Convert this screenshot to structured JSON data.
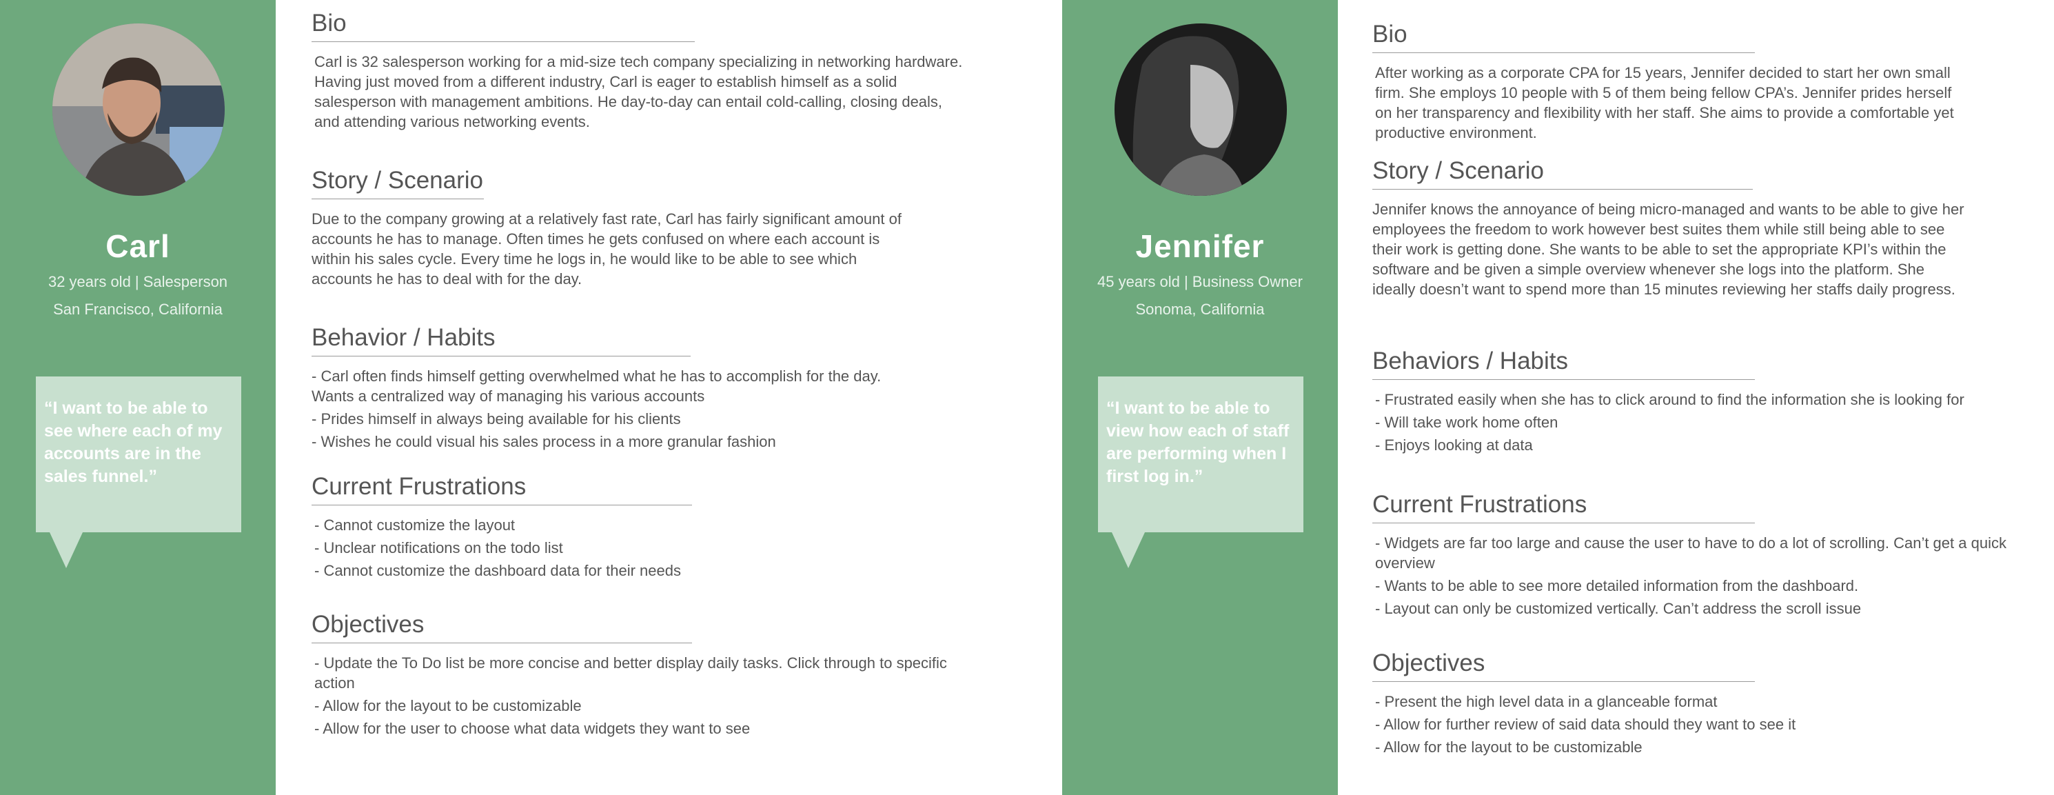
{
  "personas": [
    {
      "name": "Carl",
      "subtitle": "32 years old | Salesperson",
      "location": "San Francisco, California",
      "quote": "“I want to be able to see where each of my accounts are in the sales funnel.”",
      "sections": {
        "bio": {
          "heading": "Bio",
          "text": "Carl is 32 salesperson working for a mid-size tech company specializing in networking hardware. Having just moved from a different industry, Carl is eager to establish himself as a solid salesperson with management ambitions. He day-to-day can entail cold-calling, closing deals, and attending various networking events."
        },
        "story": {
          "heading": "Story / Scenario",
          "text": "Due to the company growing at a relatively fast rate, Carl has fairly significant amount of accounts he has to manage. Often times he gets confused on where each account is within his sales cycle. Every time he logs in, he would like to be able to see which accounts he has to deal with for the day."
        },
        "behavior": {
          "heading": "Behavior / Habits",
          "items": [
            "- Carl often finds himself getting overwhelmed what he has to accomplish for the day. Wants a centralized way of managing his various accounts",
            "- Prides himself in always being available for his clients",
            "- Wishes he could visual his sales process in a more granular fashion"
          ]
        },
        "frustrations": {
          "heading": "Current Frustrations",
          "items": [
            "- Cannot customize the layout",
            "- Unclear notifications on the todo list",
            "- Cannot customize the dashboard data for their needs"
          ]
        },
        "objectives": {
          "heading": "Objectives",
          "items": [
            "- Update the To Do list be more concise and better display daily tasks. Click through to specific action",
            "- Allow for the layout to be customizable",
            "- Allow for the user to choose what data widgets they want to see"
          ]
        }
      }
    },
    {
      "name": "Jennifer",
      "subtitle": "45 years old | Business Owner",
      "location": "Sonoma, California",
      "quote": "“I want to be able to view how each of staff are performing when I first log in.”",
      "sections": {
        "bio": {
          "heading": "Bio",
          "text": "After working as a corporate CPA for 15 years, Jennifer decided to start her own small firm. She employs 10 people with 5 of them being fellow CPA’s. Jennifer prides herself on her transparency and flexibility with her staff. She aims to provide a comfortable yet productive environment."
        },
        "story": {
          "heading": "Story / Scenario",
          "text": "Jennifer knows the annoyance of being micro-managed and wants to be able to give her employees the freedom to work however best suites them while still being able to see their work is getting done. She wants to be able to set the appropriate KPI’s within the software and be given a simple overview whenever she logs into the platform. She ideally doesn’t want to spend more than 15 minutes reviewing her staffs daily progress."
        },
        "behavior": {
          "heading": "Behaviors / Habits",
          "items": [
            "- Frustrated easily when she has to click around to find the information she is looking for",
            "- Will take work home often",
            "- Enjoys looking at data"
          ]
        },
        "frustrations": {
          "heading": "Current Frustrations",
          "items": [
            "- Widgets are far too large and cause the user to have to do a lot of scrolling. Can’t get a quick overview",
            "- Wants to be able to see more detailed information from the dashboard.",
            "- Layout can only be customized vertically. Can’t address the scroll issue"
          ]
        },
        "objectives": {
          "heading": "Objectives",
          "items": [
            "- Present the high level data in a glanceable format",
            "- Allow for further review of said data should they want to see it",
            "- Allow for the layout to be customizable"
          ]
        }
      }
    }
  ],
  "colors": {
    "sidebar": "#6ea97d",
    "quote_bubble": "#c8e0cf",
    "text": "#555555",
    "rule": "#9a9a9a"
  }
}
